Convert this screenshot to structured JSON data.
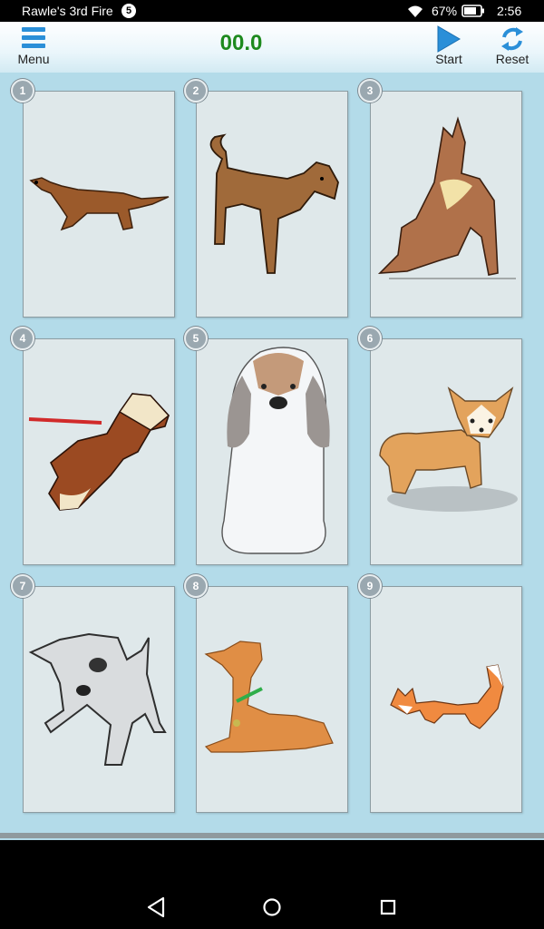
{
  "status_bar": {
    "title": "Rawle's 3rd Fire",
    "notification_count": "5",
    "battery": "67%",
    "time": "2:56",
    "icons": [
      "wifi-icon",
      "battery-icon"
    ]
  },
  "toolbar": {
    "menu_label": "Menu",
    "timer": "00.0",
    "start_label": "Start",
    "reset_label": "Reset",
    "timer_color": "#1e8a1e"
  },
  "cards": [
    {
      "number": "1",
      "picture": "dachshund"
    },
    {
      "number": "2",
      "picture": "brown-terrier"
    },
    {
      "number": "3",
      "picture": "stretching-dog"
    },
    {
      "number": "4",
      "picture": "beagle-on-leash"
    },
    {
      "number": "5",
      "picture": "sitting-beagle-puppy"
    },
    {
      "number": "6",
      "picture": "corgi-puppy"
    },
    {
      "number": "7",
      "picture": "gray-terrier-sketch"
    },
    {
      "number": "8",
      "picture": "lying-airedale"
    },
    {
      "number": "9",
      "picture": "fox"
    }
  ],
  "nav_bar": {
    "icons": [
      "back-icon",
      "home-icon",
      "recents-icon"
    ]
  },
  "colors": {
    "app_background": "#b3dbe9",
    "card_background": "#dfe8ea",
    "badge": "#9aa8b0",
    "accent_blue": "#2a8fd8"
  }
}
